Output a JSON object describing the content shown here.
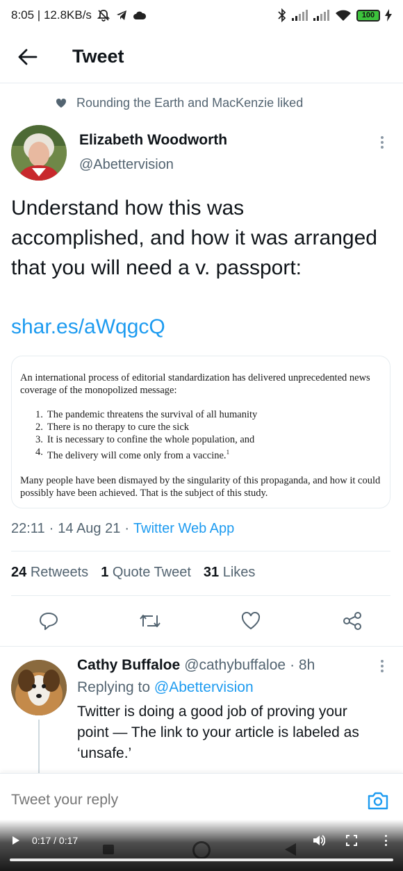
{
  "status_bar": {
    "time_speed": "8:05 | 12.8KB/s",
    "battery": "100",
    "icons": [
      "mute-bell-icon",
      "telegram-icon",
      "cloud-icon",
      "bluetooth-icon",
      "signal-icon",
      "signal-icon",
      "wifi-icon",
      "battery-icon",
      "charging-bolt-icon"
    ]
  },
  "header": {
    "title": "Tweet",
    "back_icon": "back-arrow-icon"
  },
  "social_context": "Rounding the Earth and MacKenzie liked",
  "tweet": {
    "author_name": "Elizabeth Woodworth",
    "author_handle": "@Abettervision",
    "text": "Understand how this was accomplished, and how it was arranged that you will need a v. passport:",
    "link": "shar.es/aWqgcQ",
    "image": {
      "intro": "An international process of editorial standardization has delivered unprecedented news coverage of the monopolized message:",
      "items": [
        {
          "num": "1.",
          "text": "The pandemic threatens the survival of all humanity"
        },
        {
          "num": "2.",
          "text": "There is no therapy to cure the sick"
        },
        {
          "num": "3.",
          "text": "It is necessary to confine the whole population, and"
        },
        {
          "num": "4.",
          "text": "The delivery will come only from a vaccine."
        }
      ],
      "footnote_mark": "1",
      "outro": "Many people have been dismayed by the singularity of this propaganda, and how it could possibly have been achieved.  That is the subject of this study."
    },
    "time": "22:11",
    "date": "14 Aug 21",
    "separator": "·",
    "source": "Twitter Web App",
    "retweets_count": "24",
    "retweets_label": "Retweets",
    "quotes_count": "1",
    "quotes_label": "Quote Tweet",
    "likes_count": "31",
    "likes_label": "Likes"
  },
  "reply": {
    "author_name": "Cathy Buffaloe",
    "author_handle": "@cathybuffaloe",
    "time": "· 8h",
    "replying_prefix": "Replying to",
    "replying_to": "@Abettervision",
    "text": "Twitter is doing a good job of proving your point — The link to your article is labeled as ‘unsafe.’"
  },
  "composer": {
    "placeholder": "Tweet your reply"
  },
  "video_bar": {
    "time": "0:17 / 0:17",
    "progress": 1.0
  },
  "colors": {
    "accent": "#1d9bf0",
    "text_primary": "#0f1419",
    "text_secondary": "#536471",
    "battery_green": "#3cc33c"
  }
}
